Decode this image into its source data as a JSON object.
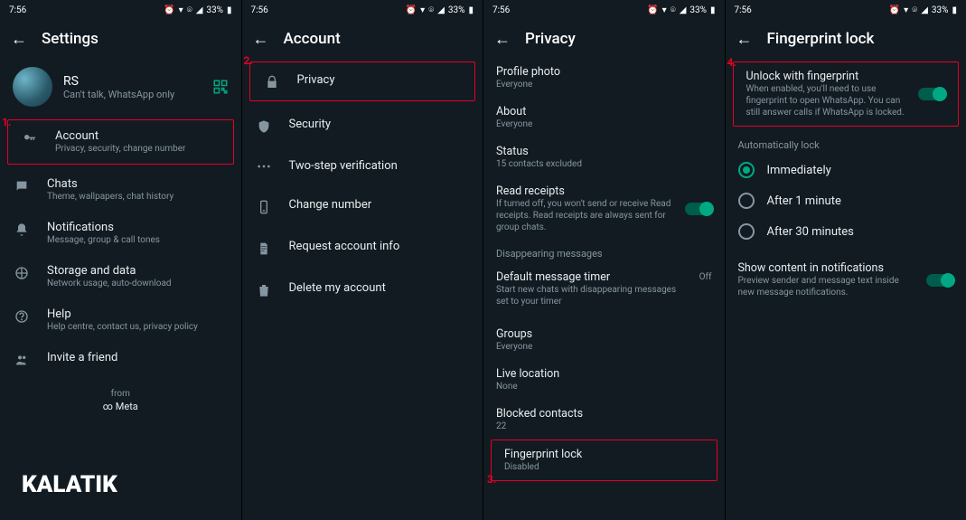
{
  "status": {
    "time": "7:56",
    "battery": "33%"
  },
  "screen1": {
    "title": "Settings",
    "profile": {
      "name": "RS",
      "status": "Can't talk, WhatsApp only"
    },
    "items": [
      {
        "title": "Account",
        "sub": "Privacy, security, change number"
      },
      {
        "title": "Chats",
        "sub": "Theme, wallpapers, chat history"
      },
      {
        "title": "Notifications",
        "sub": "Message, group & call tones"
      },
      {
        "title": "Storage and data",
        "sub": "Network usage, auto-download"
      },
      {
        "title": "Help",
        "sub": "Help centre, contact us, privacy policy"
      },
      {
        "title": "Invite a friend",
        "sub": ""
      }
    ],
    "footer_from": "from",
    "footer_brand": "∞ Meta",
    "step": "1."
  },
  "screen2": {
    "title": "Account",
    "items": [
      {
        "title": "Privacy"
      },
      {
        "title": "Security"
      },
      {
        "title": "Two-step verification"
      },
      {
        "title": "Change number"
      },
      {
        "title": "Request account info"
      },
      {
        "title": "Delete my account"
      }
    ],
    "step": "2."
  },
  "screen3": {
    "title": "Privacy",
    "items": [
      {
        "title": "Profile photo",
        "sub": "Everyone"
      },
      {
        "title": "About",
        "sub": "Everyone"
      },
      {
        "title": "Status",
        "sub": "15 contacts excluded"
      },
      {
        "title": "Read receipts",
        "sub": "If turned off, you won't send or receive Read receipts. Read receipts are always sent for group chats."
      }
    ],
    "disappearing_header": "Disappearing messages",
    "default_timer": {
      "title": "Default message timer",
      "sub": "Start new chats with disappearing messages set to your timer",
      "value": "Off"
    },
    "groups": {
      "title": "Groups",
      "sub": "Everyone"
    },
    "live": {
      "title": "Live location",
      "sub": "None"
    },
    "blocked": {
      "title": "Blocked contacts",
      "sub": "22"
    },
    "fingerprint": {
      "title": "Fingerprint lock",
      "sub": "Disabled"
    },
    "step": "3."
  },
  "screen4": {
    "title": "Fingerprint lock",
    "unlock": {
      "title": "Unlock with fingerprint",
      "sub": "When enabled, you'll need to use fingerprint to open WhatsApp. You can still answer calls if WhatsApp is locked."
    },
    "auto_header": "Automatically lock",
    "radios": [
      {
        "label": "Immediately",
        "active": true
      },
      {
        "label": "After 1 minute",
        "active": false
      },
      {
        "label": "After 30 minutes",
        "active": false
      }
    ],
    "show_content": {
      "title": "Show content in notifications",
      "sub": "Preview sender and message text inside new message notifications."
    },
    "step": "4."
  },
  "watermark": "KALATIK"
}
